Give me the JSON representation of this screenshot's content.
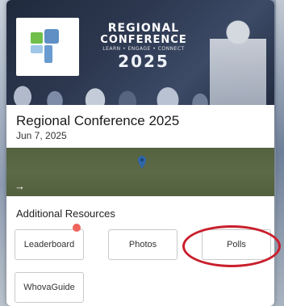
{
  "banner": {
    "title_line1": "REGIONAL",
    "title_line2": "CONFERENCE",
    "tagline": "LEARN • ENGAGE • CONNECT",
    "year": "2025"
  },
  "event": {
    "title": "Regional Conference 2025",
    "date": "Jun 7, 2025"
  },
  "resources": {
    "heading": "Additional Resources",
    "buttons": {
      "leaderboard": "Leaderboard",
      "photos": "Photos",
      "polls": "Polls",
      "guide": "WhovaGuide"
    }
  },
  "map": {
    "arrow": "→"
  },
  "colors": {
    "badge": "#f0645d",
    "highlight_circle": "#c91f2c",
    "map_green": "#5c6a47",
    "banner_navy": "#2d3850"
  }
}
